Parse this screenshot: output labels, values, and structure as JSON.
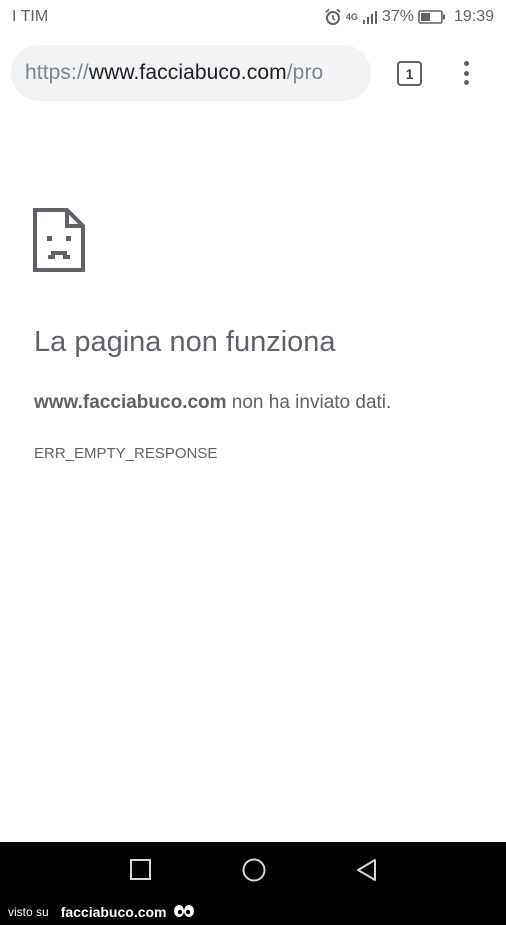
{
  "status_bar": {
    "carrier": "I TIM",
    "network": "4G",
    "battery": "37%",
    "time": "19:39",
    "icons": [
      "alarm-icon",
      "signal-icon",
      "battery-icon"
    ]
  },
  "browser": {
    "url_scheme": "https://",
    "url_host": "www.facciabuco.com",
    "url_path": "/pro",
    "tab_count": "1",
    "icons": [
      "tab-switcher-icon",
      "overflow-menu-icon"
    ]
  },
  "error": {
    "icon": "sad-page-icon",
    "title": "La pagina non funziona",
    "host": "www.facciabuco.com",
    "message": " non ha inviato dati.",
    "code": "ERR_EMPTY_RESPONSE"
  },
  "nav_bar": {
    "icons": [
      "recents-icon",
      "home-icon",
      "back-icon"
    ]
  },
  "watermark": {
    "prefix": "visto su",
    "brand": "facciabuco.com"
  },
  "colors": {
    "omnibox_bg": "#f1f3f4",
    "text_secondary": "#5f6368",
    "nav_bg": "#000000"
  }
}
